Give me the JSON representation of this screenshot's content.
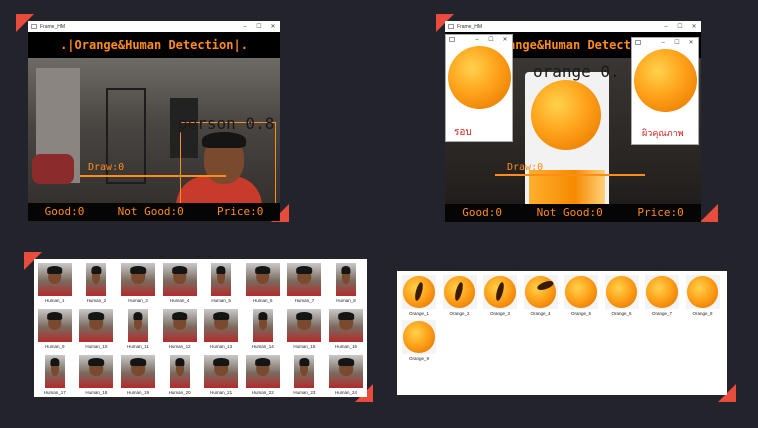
{
  "colors": {
    "accent": "#e84c3d",
    "hud_text": "#ff8c1a",
    "background": "#23232b"
  },
  "camera_window": {
    "title": "Frame_HM",
    "banner": ".|Orange&Human Detection|.",
    "detection_label": "person 0.8",
    "line_label": "Draw:0",
    "hud": {
      "good": "Good:0",
      "not_good": "Not Good:0",
      "price": "Price:0"
    },
    "controls": {
      "minimize": "–",
      "maximize": "☐",
      "close": "✕"
    }
  },
  "orange_window": {
    "title": "Frame_HM",
    "banner": ".|Orange&Human Detection|.",
    "detection_label": "orange 0.",
    "line_label": "Draw:0",
    "hud": {
      "good": "Good:0",
      "not_good": "Not Good:0",
      "price": "Price:0"
    },
    "popup_left_label": "รอบ",
    "popup_right_label": "ผิวคุณภาพ",
    "controls": {
      "minimize": "–",
      "maximize": "☐",
      "close": "✕"
    }
  },
  "human_gallery": [
    "Human_1",
    "Human_2",
    "Human_3",
    "Human_4",
    "Human_5",
    "Human_6",
    "Human_7",
    "Human_8",
    "Human_9",
    "Human_10",
    "Human_11",
    "Human_12",
    "Human_13",
    "Human_14",
    "Human_15",
    "Human_16",
    "Human_17",
    "Human_18",
    "Human_19",
    "Human_20",
    "Human_21",
    "Human_22",
    "Human_23",
    "Human_24"
  ],
  "orange_gallery": [
    "Orange_1",
    "Orange_2",
    "Orange_3",
    "Orange_4",
    "Orange_5",
    "Orange_6",
    "Orange_7",
    "Orange_8",
    "Orange_9"
  ]
}
